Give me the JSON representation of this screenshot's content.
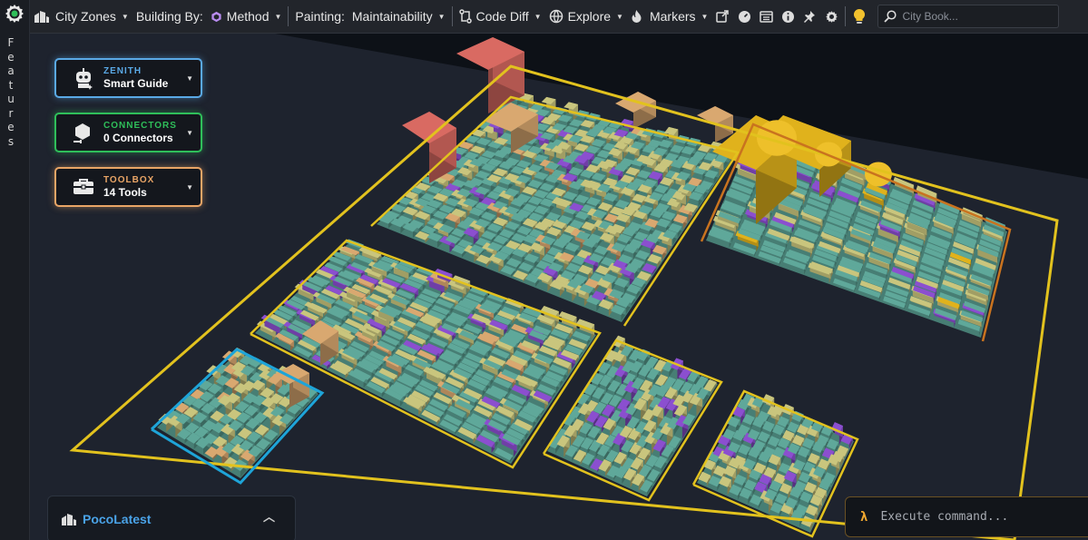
{
  "sidebar": {
    "label_letters": [
      "F",
      "e",
      "a",
      "t",
      "u",
      "r",
      "e",
      "s"
    ]
  },
  "toolbar": {
    "city_zones": "City Zones",
    "building_by_label": "Building By:",
    "building_by_value": "Method",
    "painting_label": "Painting:",
    "painting_value": "Maintainability",
    "code_diff": "Code Diff",
    "explore": "Explore",
    "markers": "Markers",
    "search_placeholder": "City Book..."
  },
  "panels": {
    "zenith": {
      "kicker": "ZENITH",
      "title": "Smart Guide"
    },
    "connectors": {
      "kicker": "CONNECTORS",
      "title": "0 Connectors"
    },
    "toolbox": {
      "kicker": "TOOLBOX",
      "title": "14 Tools"
    }
  },
  "project": {
    "name": "PocoLatest"
  },
  "command": {
    "placeholder": "Execute command..."
  },
  "colors": {
    "accent": "#4aa3e8",
    "zone_outline": "#e2c21e",
    "teal": "#5fa89a",
    "khaki": "#c9c57d",
    "violet": "#8b4fcf",
    "salmon": "#d96a62",
    "gold": "#e0b21c"
  }
}
